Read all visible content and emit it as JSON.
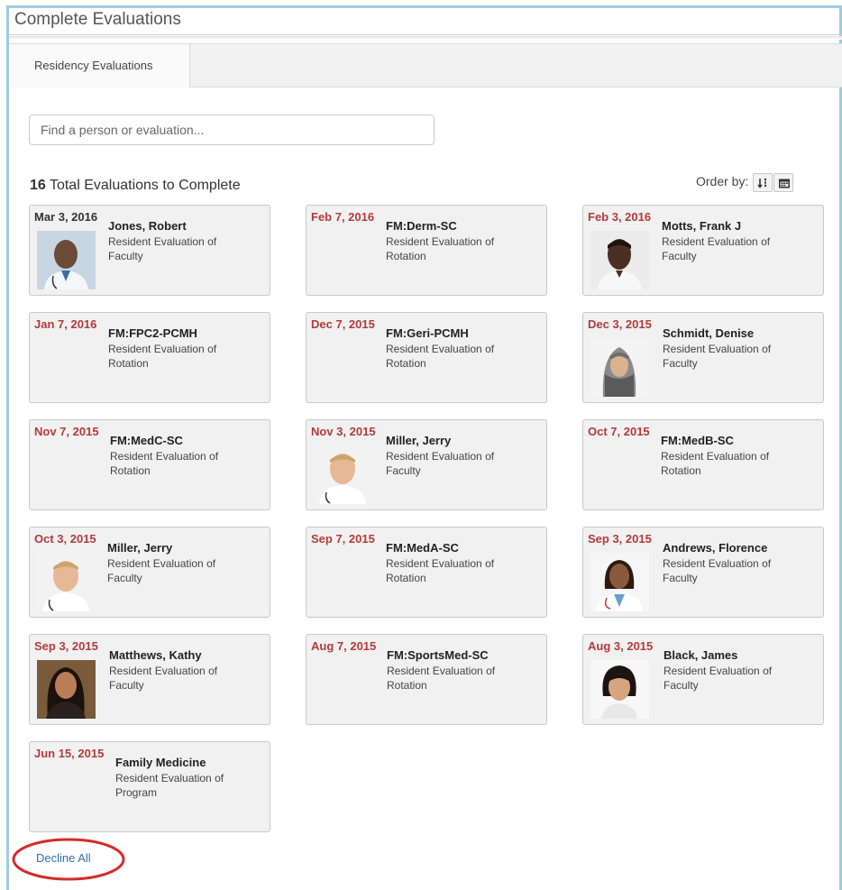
{
  "app": {
    "title": "Complete Evaluations"
  },
  "tabs": [
    {
      "label": "Residency Evaluations"
    }
  ],
  "search": {
    "placeholder": "Find a person or evaluation..."
  },
  "summary": {
    "count": "16",
    "label": "Total Evaluations to Complete"
  },
  "order_by": {
    "label": "Order by:",
    "options": [
      "sort-icon",
      "calendar-icon"
    ]
  },
  "colors": {
    "date_red": "#b33a3a",
    "card_bg": "#f1f1f1",
    "frame_blue": "#9ecde0",
    "link_blue": "#2f6fa7",
    "oval_red": "#d42b2b"
  },
  "cards": [
    {
      "date": "Mar 3, 2016",
      "name": "Jones, Robert",
      "type": "Resident Evaluation of Faculty",
      "photo": "man-doctor-smiling"
    },
    {
      "date": "Feb 7, 2016",
      "name": "FM:Derm-SC",
      "type": "Resident Evaluation of Rotation"
    },
    {
      "date": "Feb 3, 2016",
      "name": "Motts, Frank J",
      "type": "Resident Evaluation of Faculty",
      "photo": "man-doctor"
    },
    {
      "date": "Jan 7, 2016",
      "name": "FM:FPC2-PCMH",
      "type": "Resident Evaluation of Rotation"
    },
    {
      "date": "Dec 7, 2015",
      "name": "FM:Geri-PCMH",
      "type": "Resident Evaluation of Rotation"
    },
    {
      "date": "Dec 3, 2015",
      "name": "Schmidt, Denise",
      "type": "Resident Evaluation of Faculty",
      "photo": "woman-headscarf"
    },
    {
      "date": "Nov 7, 2015",
      "name": "FM:MedC-SC",
      "type": "Resident Evaluation of Rotation"
    },
    {
      "date": "Nov 3, 2015",
      "name": "Miller, Jerry",
      "type": "Resident Evaluation of Faculty",
      "photo": "man-doctor-blond"
    },
    {
      "date": "Oct 7, 2015",
      "name": "FM:MedB-SC",
      "type": "Resident Evaluation of Rotation"
    },
    {
      "date": "Oct 3, 2015",
      "name": "Miller, Jerry",
      "type": "Resident Evaluation of Faculty",
      "photo": "man-doctor-blond"
    },
    {
      "date": "Sep 7, 2015",
      "name": "FM:MedA-SC",
      "type": "Resident Evaluation of Rotation"
    },
    {
      "date": "Sep 3, 2015",
      "name": "Andrews, Florence",
      "type": "Resident Evaluation of Faculty",
      "photo": "woman-doctor"
    },
    {
      "date": "Sep 3, 2015",
      "name": "Matthews, Kathy",
      "type": "Resident Evaluation of Faculty",
      "photo": "woman-smiling"
    },
    {
      "date": "Aug 7, 2015",
      "name": "FM:SportsMed-SC",
      "type": "Resident Evaluation of Rotation"
    },
    {
      "date": "Aug 3, 2015",
      "name": "Black, James",
      "type": "Resident Evaluation of Faculty",
      "photo": "man-smiling"
    },
    {
      "date": "Jun 15, 2015",
      "name": "Family Medicine",
      "type": "Resident Evaluation of Program"
    }
  ],
  "footer": {
    "decline_all": "Decline All"
  }
}
